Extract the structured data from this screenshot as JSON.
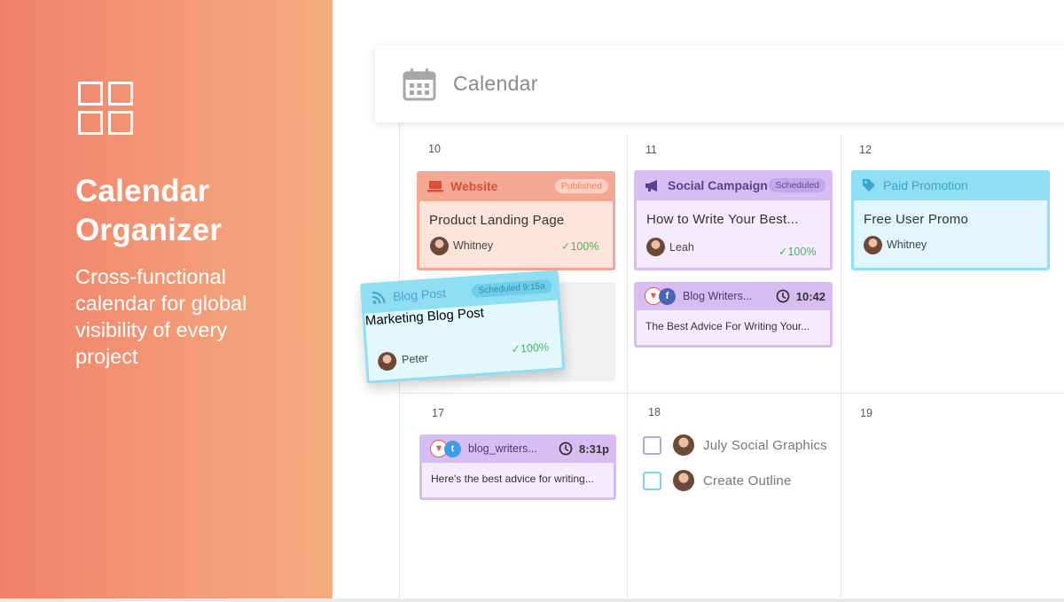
{
  "hero": {
    "title": "Calendar Organizer",
    "description": "Cross-functional calendar for global visibility of every project"
  },
  "calendar": {
    "title": "Calendar",
    "days": [
      "10",
      "11",
      "12",
      "17",
      "18",
      "19"
    ],
    "cards": {
      "website": {
        "category": "Website",
        "status": "Published",
        "title": "Product Landing Page",
        "person": "Whitney",
        "progress": "100%"
      },
      "social": {
        "category": "Social Campaign",
        "status": "Scheduled",
        "title": "How to Write Your Best...",
        "person": "Leah",
        "progress": "100%"
      },
      "paid": {
        "category": "Paid Promotion",
        "title": "Free User Promo",
        "person": "Whitney"
      },
      "blog_writers_fb": {
        "account": "Blog Writers...",
        "time": "10:42",
        "text": "The Best Advice For Writing Your..."
      },
      "blog_writers_tw": {
        "account": "blog_writers...",
        "time": "8:31p",
        "text": "Here's the best advice for writing..."
      },
      "blog_post": {
        "category": "Blog Post",
        "status": "Scheduled 9:15a",
        "title": "Marketing Blog Post",
        "person": "Peter",
        "progress": "100%"
      }
    },
    "tasks": [
      {
        "label": "July Social Graphics",
        "checkbox_color": "#b8a4e8"
      },
      {
        "label": "Create Outline",
        "checkbox_color": "#7fd3ec"
      }
    ]
  },
  "colors": {
    "hero_gradient_start": "#f0806a",
    "hero_gradient_end": "#f5ab80",
    "website": "#f4a792",
    "social": "#d7bdf2",
    "paid": "#8fdff4",
    "success": "#4bb35e"
  },
  "icons": {
    "logo": "grid-four-squares-icon",
    "calendar": "calendar-icon",
    "website": "laptop-icon",
    "social": "megaphone-icon",
    "paid": "tag-icon",
    "blog": "rss-icon",
    "facebook": "facebook-icon",
    "twitter": "twitter-icon",
    "clock": "clock-icon",
    "check": "check-icon"
  }
}
